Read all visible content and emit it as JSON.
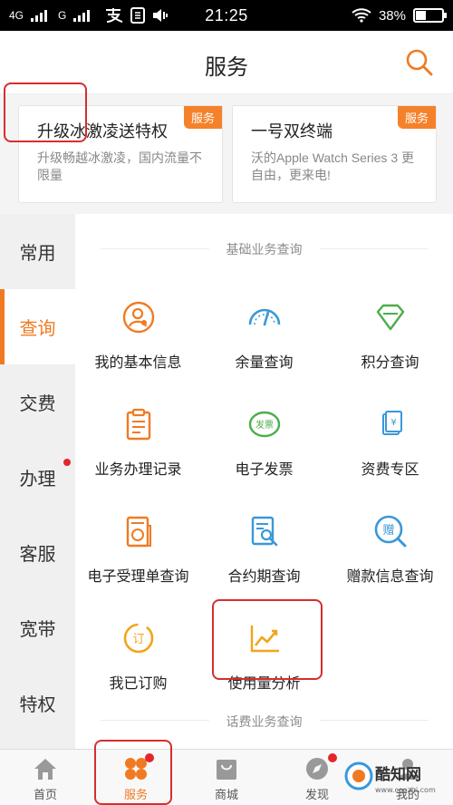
{
  "status_bar": {
    "network1": "4G",
    "network2": "G",
    "time": "21:25",
    "battery": "38%",
    "battery_fraction": 0.38
  },
  "header": {
    "title": "服务",
    "search_icon": "search-icon"
  },
  "promos": [
    {
      "title": "升级冰激凌送特权",
      "desc": "升级畅越冰激凌，国内流量不限量",
      "badge": "服务"
    },
    {
      "title": "一号双终端",
      "desc": "沃的Apple Watch Series 3 更自由，更来电!",
      "badge": "服务"
    }
  ],
  "sidebar": {
    "items": [
      {
        "label": "常用"
      },
      {
        "label": "查询"
      },
      {
        "label": "交费"
      },
      {
        "label": "办理"
      },
      {
        "label": "客服"
      },
      {
        "label": "宽带"
      },
      {
        "label": "特权"
      }
    ],
    "active": "查询"
  },
  "sections": {
    "basic_title": "基础业务查询",
    "fee_title": "话费业务查询"
  },
  "grid": {
    "items": [
      {
        "label": "我的基本信息",
        "icon": "person-icon"
      },
      {
        "label": "余量查询",
        "icon": "gauge-icon"
      },
      {
        "label": "积分查询",
        "icon": "diamond-icon"
      },
      {
        "label": "业务办理记录",
        "icon": "clipboard-icon"
      },
      {
        "label": "电子发票",
        "icon": "invoice-icon",
        "icon_text": "发票"
      },
      {
        "label": "资费专区",
        "icon": "price-tag-icon",
        "icon_text": "¥"
      },
      {
        "label": "电子受理单查询",
        "icon": "receipt-icon"
      },
      {
        "label": "合约期查询",
        "icon": "contract-search-icon"
      },
      {
        "label": "赠款信息查询",
        "icon": "gift-search-icon",
        "icon_text": "赠"
      },
      {
        "label": "我已订购",
        "icon": "subscribed-icon",
        "icon_text": "订"
      },
      {
        "label": "使用量分析",
        "icon": "trend-chart-icon"
      }
    ]
  },
  "bottom_nav": {
    "items": [
      {
        "label": "首页",
        "icon": "home-icon"
      },
      {
        "label": "服务",
        "icon": "service-icon"
      },
      {
        "label": "商城",
        "icon": "shop-bag-icon"
      },
      {
        "label": "发现",
        "icon": "compass-icon"
      },
      {
        "label": "我的",
        "icon": "user-icon"
      }
    ],
    "active": "服务"
  },
  "watermark": {
    "brand": "酷知网",
    "url": "www.coozhi.com"
  },
  "colors": {
    "accent": "#f07a22",
    "badge": "#f5822a",
    "highlight": "#d62e2e",
    "dot": "#e3262e"
  }
}
